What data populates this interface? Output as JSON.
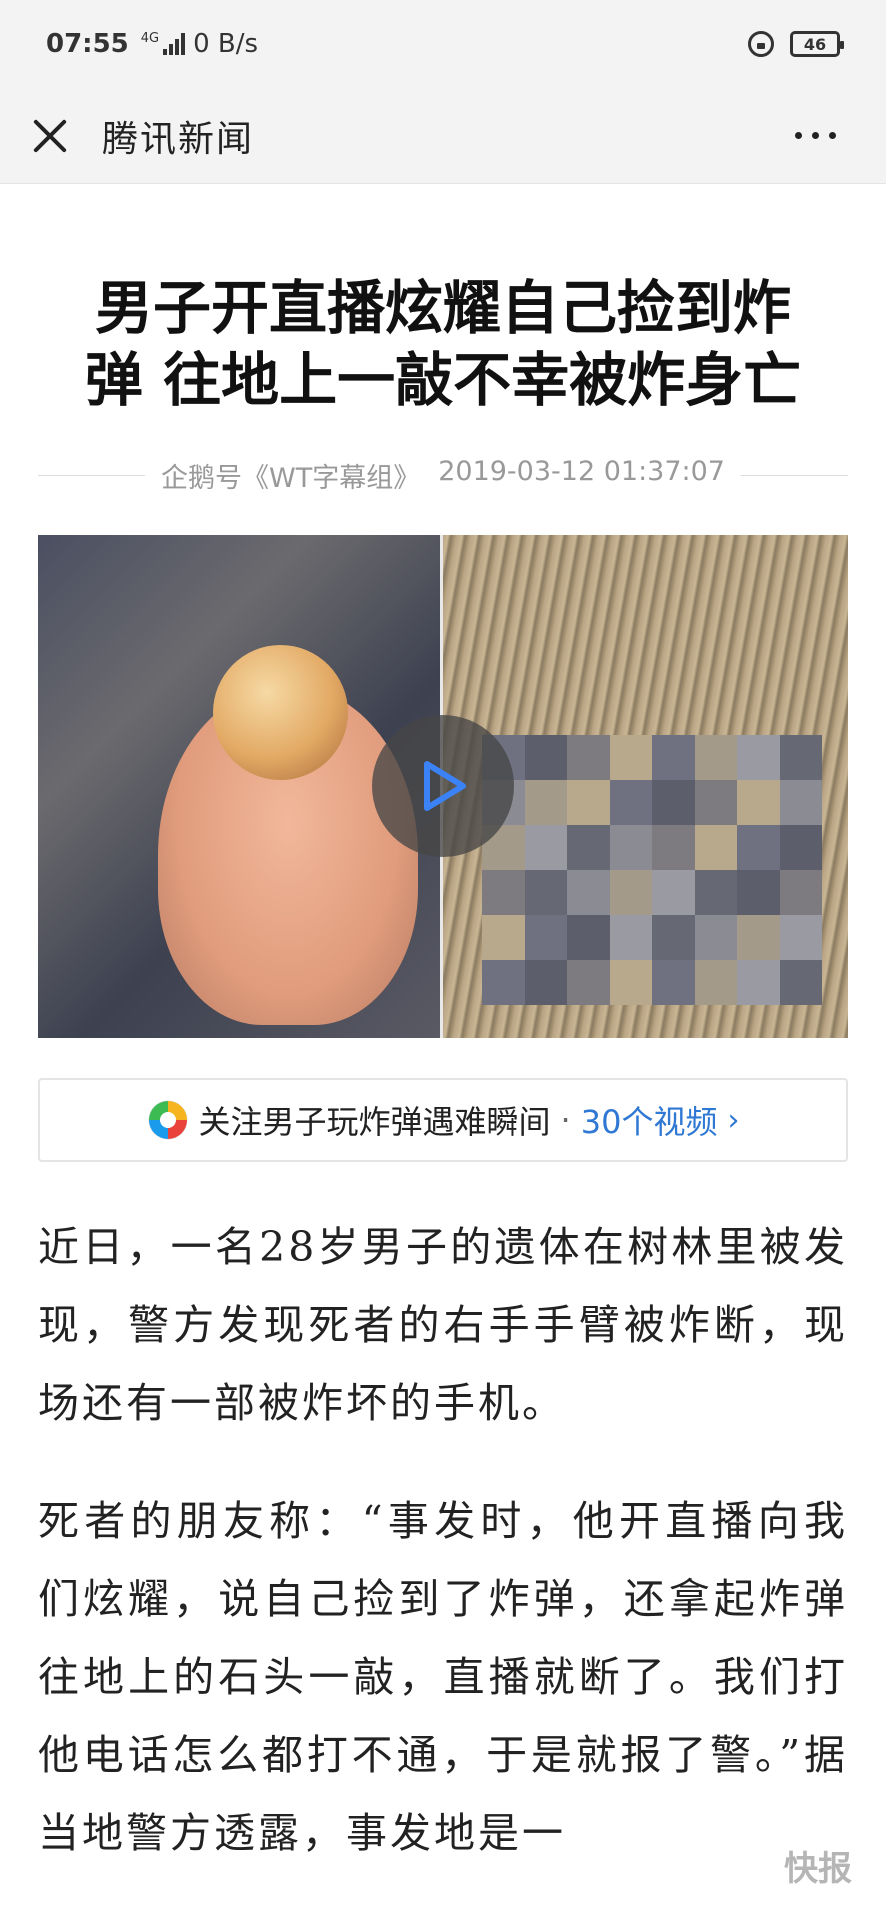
{
  "status_bar": {
    "time": "07:55",
    "network": "4G",
    "speed": "0 B/s",
    "battery": "46"
  },
  "app_bar": {
    "title": "腾讯新闻"
  },
  "article": {
    "headline": "男子开直播炫耀自己捡到炸弹 往地上一敲不幸被炸身亡",
    "source": "企鹅号《WT字幕组》",
    "datetime": "2019-03-12 01:37:07",
    "follow": {
      "label": "关注男子玩炸弹遇难瞬间",
      "separator": "·",
      "count": "30个视频",
      "chevron": "›"
    },
    "paragraphs": [
      "近日，一名28岁男子的遗体在树林里被发现，警方发现死者的右手手臂被炸断，现场还有一部被炸坏的手机。",
      "死者的朋友称：“事发时，他开直播向我们炫耀，说自己捡到了炸弹，还拿起炸弹往地上的石头一敲，直播就断了。我们打他电话怎么都打不通，于是就报了警。”据当地警方透露，事发地是一"
    ]
  },
  "icons": {
    "close": "close-icon",
    "more": "more-icon",
    "play": "play-icon",
    "lock": "lock-rotation-icon",
    "logo": "tencent-video-logo-icon"
  },
  "colors": {
    "link_blue": "#2f78d3",
    "bar_bg": "#f3f3f3"
  }
}
